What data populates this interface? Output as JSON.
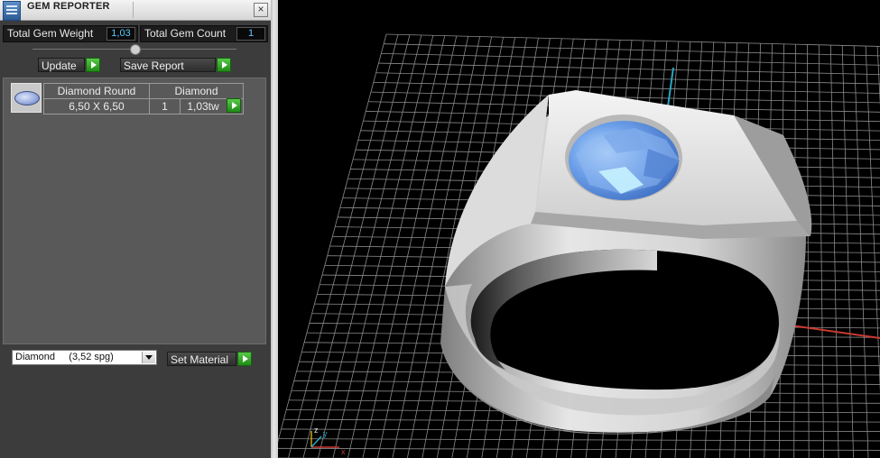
{
  "window": {
    "title": "GEM REPORTER",
    "close_label": "×"
  },
  "stats": {
    "total_weight_label": "Total Gem Weight",
    "total_weight_value": "1,03",
    "total_count_label": "Total Gem Count",
    "total_count_value": "1"
  },
  "actions": {
    "update_label": "Update",
    "save_report_label": "Save Report"
  },
  "gem_row": {
    "name": "Diamond Round",
    "size": "6,50 X 6,50",
    "material": "Diamond",
    "count": "1",
    "weight": "1,03tw"
  },
  "material_select": {
    "selected": "Diamond     (3,52 spg)"
  },
  "set_material_label": "Set Material",
  "axis_gizmo": {
    "z": "z",
    "y": "y",
    "x": "x"
  },
  "colors": {
    "panel_bg": "#3c3c3c",
    "value_blue": "#5cc8ff",
    "play_green": "#2faa22",
    "axis_red": "#c83a30",
    "axis_cyan": "#2aa7c4",
    "gem_blue": "#6b9ee8"
  },
  "icons": [
    "gem-reporter-app-icon",
    "close-icon",
    "play-arrow-icon",
    "dropdown-arrow-icon",
    "axis-gizmo-icon"
  ]
}
